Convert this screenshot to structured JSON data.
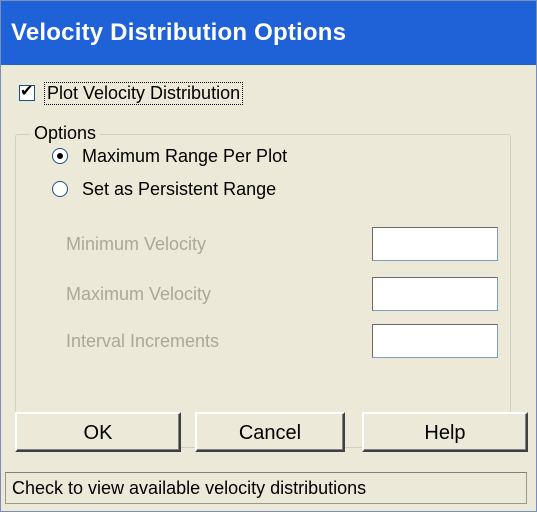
{
  "window": {
    "title": "Velocity Distribution Options"
  },
  "plot_checkbox": {
    "label": "Plot Velocity Distribution",
    "checked": true
  },
  "options_group": {
    "legend": "Options",
    "radios": [
      {
        "label": "Maximum Range Per Plot",
        "selected": true
      },
      {
        "label": "Set as Persistent Range",
        "selected": false
      }
    ],
    "fields": [
      {
        "label": "Minimum Velocity",
        "value": ""
      },
      {
        "label": "Maximum Velocity",
        "value": ""
      },
      {
        "label": "Interval Increments",
        "value": ""
      }
    ]
  },
  "buttons": {
    "ok": "OK",
    "cancel": "Cancel",
    "help": "Help"
  },
  "status_bar": {
    "text": "Check to view available velocity distributions"
  },
  "colors": {
    "title_bar": "#1f61d7",
    "dialog_bg": "#ece9d8",
    "disabled_text": "#aca899"
  },
  "icons": {
    "checkmark": "checkmark-icon",
    "radio_selected": "radio-selected-dot"
  }
}
